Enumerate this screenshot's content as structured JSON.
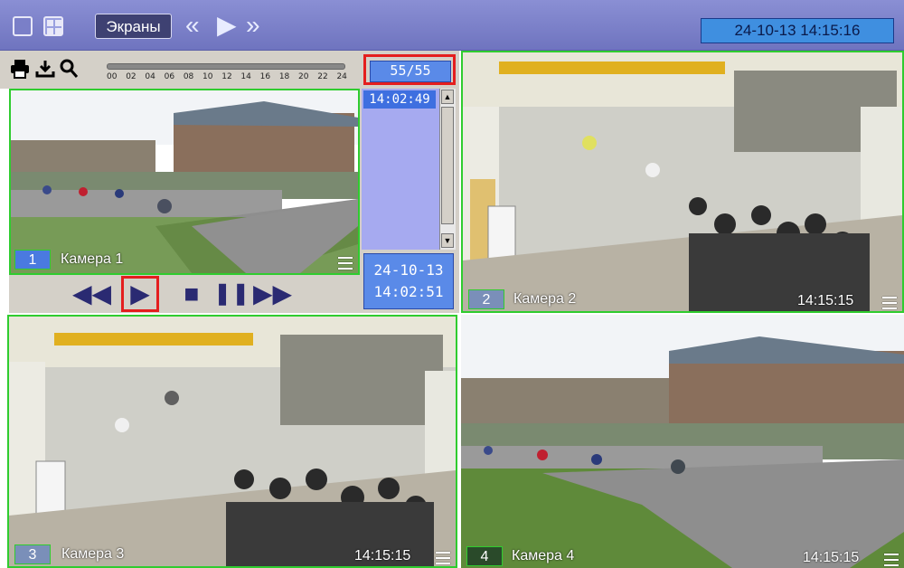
{
  "topbar": {
    "screens_label": "Экраны",
    "datetime": "24-10-13  14:15:16",
    "nav_icons": [
      "«",
      "▶",
      "»"
    ]
  },
  "toolbar": {
    "icons": [
      "print-icon",
      "download-icon",
      "search-icon"
    ],
    "timeline_ticks": [
      "00",
      "02",
      "04",
      "06",
      "08",
      "10",
      "12",
      "14",
      "16",
      "18",
      "20",
      "22",
      "24"
    ]
  },
  "archive": {
    "counter": "55/55",
    "list": [
      "14:02:49"
    ],
    "date": "24-10-13",
    "time": "14:02:51"
  },
  "controls": {
    "rewind_icon": "◀◀",
    "play_icon": "▶",
    "stop_icon": "■",
    "pause_icon": "❚❚",
    "forward_icon": "▶▶"
  },
  "cameras": [
    {
      "number": "1",
      "name": "Камера 1",
      "time": ""
    },
    {
      "number": "2",
      "name": "Камера 2",
      "time": "14:15:15"
    },
    {
      "number": "3",
      "name": "Камера 3",
      "time": "14:15:15"
    },
    {
      "number": "4",
      "name": "Камера 4",
      "time": "14:15:15"
    }
  ],
  "colors": {
    "active_border": "#2fcc2f",
    "highlight": "#e41e1e",
    "accent": "#3f8fe0"
  }
}
